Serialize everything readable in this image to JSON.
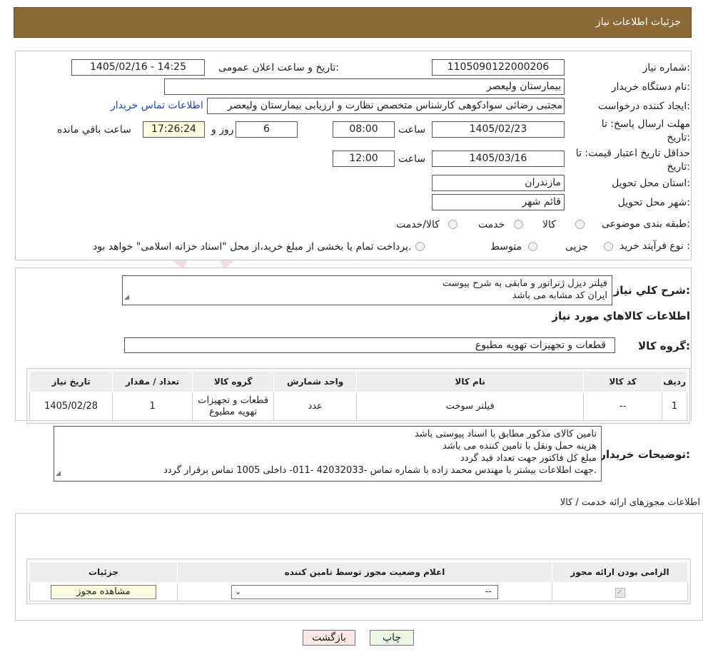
{
  "header": {
    "title": "جزئیات اطلاعات نیاز"
  },
  "form": {
    "need_number_label": "شماره نیاز:",
    "need_number": "1105090122000206",
    "announce_label": "تاریخ و ساعت اعلان عمومی:",
    "announce_value": "1405/02/16 - 14:25",
    "buyer_label": "نام دستگاه خریدار:",
    "buyer_value": "بیمارستان ولیعصر",
    "creator_label": "ایجاد کننده درخواست:",
    "creator_value": "مجتبی رضائی سوادکوهی کارشناس متخصص نظارت و ارزیابی بیمارستان ولیعصر",
    "contact_link": "اطلاعات تماس خریدار",
    "deadline_label": "مهلت ارسال پاسخ: تا تاریخ:",
    "deadline_date": "1405/02/23",
    "time_label": "ساعت",
    "deadline_time": "08:00",
    "days_value": "6",
    "days_label": "روز و",
    "remaining_time": "17:26:24",
    "remaining_label": "ساعت باقي مانده",
    "validity_label": "حداقل تاریخ اعتبار قیمت: تا تاریخ:",
    "validity_date": "1405/03/16",
    "validity_time": "12:00",
    "province_label": "استان محل تحویل:",
    "province_value": "مازندران",
    "city_label": "شهر محل تحویل:",
    "city_value": "قائم شهر",
    "category_label": "طبقه بندی موضوعی:",
    "category_options": [
      "کالا",
      "خدمت",
      "کالا/خدمت"
    ],
    "process_label": "نوع فرآیند خرید :",
    "process_options": [
      "جزیی",
      "متوسط"
    ],
    "process_note": "پرداخت تمام یا بخشی از مبلغ خرید،از محل \"اسناد خزانه اسلامی\" خواهد بود."
  },
  "description": {
    "label": "شرح کلي نياز:",
    "lines": [
      "فیلتر دیزل ژنراتور و مابقی به شرح پیوست",
      "ایران کد مشابه می باشد"
    ]
  },
  "goods": {
    "section_title": "اطلاعات کالاهاي مورد نياز",
    "group_label": "گروه کالا:",
    "group_value": "قطعات و تجهیزات تهویه مطبوع",
    "columns": [
      "ردیف",
      "کد کالا",
      "نام کالا",
      "واحد شمارش",
      "گروه کالا",
      "تعداد / مقدار",
      "تاریخ نیاز"
    ],
    "rows": [
      {
        "row": "1",
        "code": "--",
        "name": "فیلتر سوخت",
        "unit": "عدد",
        "group": "قطعات و تجهیزات تهویه مطبوع",
        "qty": "1",
        "date": "1405/02/28"
      }
    ]
  },
  "buyer_notes": {
    "label": "توضیحات خریدار:",
    "lines": [
      "تامین کالای مذکور مطابق با اسناد پیوستی باشد",
      "هزینه حمل ونقل با تامین کننده می باشد",
      "مبلغ کل  فاکتور جهت تعداد قید گردد",
      "جهت اطلاعات بیشتر با مهندس محمد زاده با شماره تماس -42032033 -011- داخلی 1005 تماس برقرار گردد."
    ]
  },
  "permits": {
    "section_title": "اطلاعات مجوزهای ارائه خدمت / کالا",
    "columns": [
      "الزامی بودن ارائه مجوز",
      "اعلام وضعیت مجوز توسط تامین کننده",
      "جزئیات"
    ],
    "select_value": "--",
    "view_button": "مشاهده مجوز"
  },
  "footer": {
    "print_label": "چاپ",
    "back_label": "بازگشت"
  },
  "watermark_text": "AriaTender.neT",
  "colors": {
    "header": "#8c6a38",
    "link": "#1a44c8",
    "print_bg": "#eaf7e3",
    "back_bg": "#fde8e8"
  }
}
